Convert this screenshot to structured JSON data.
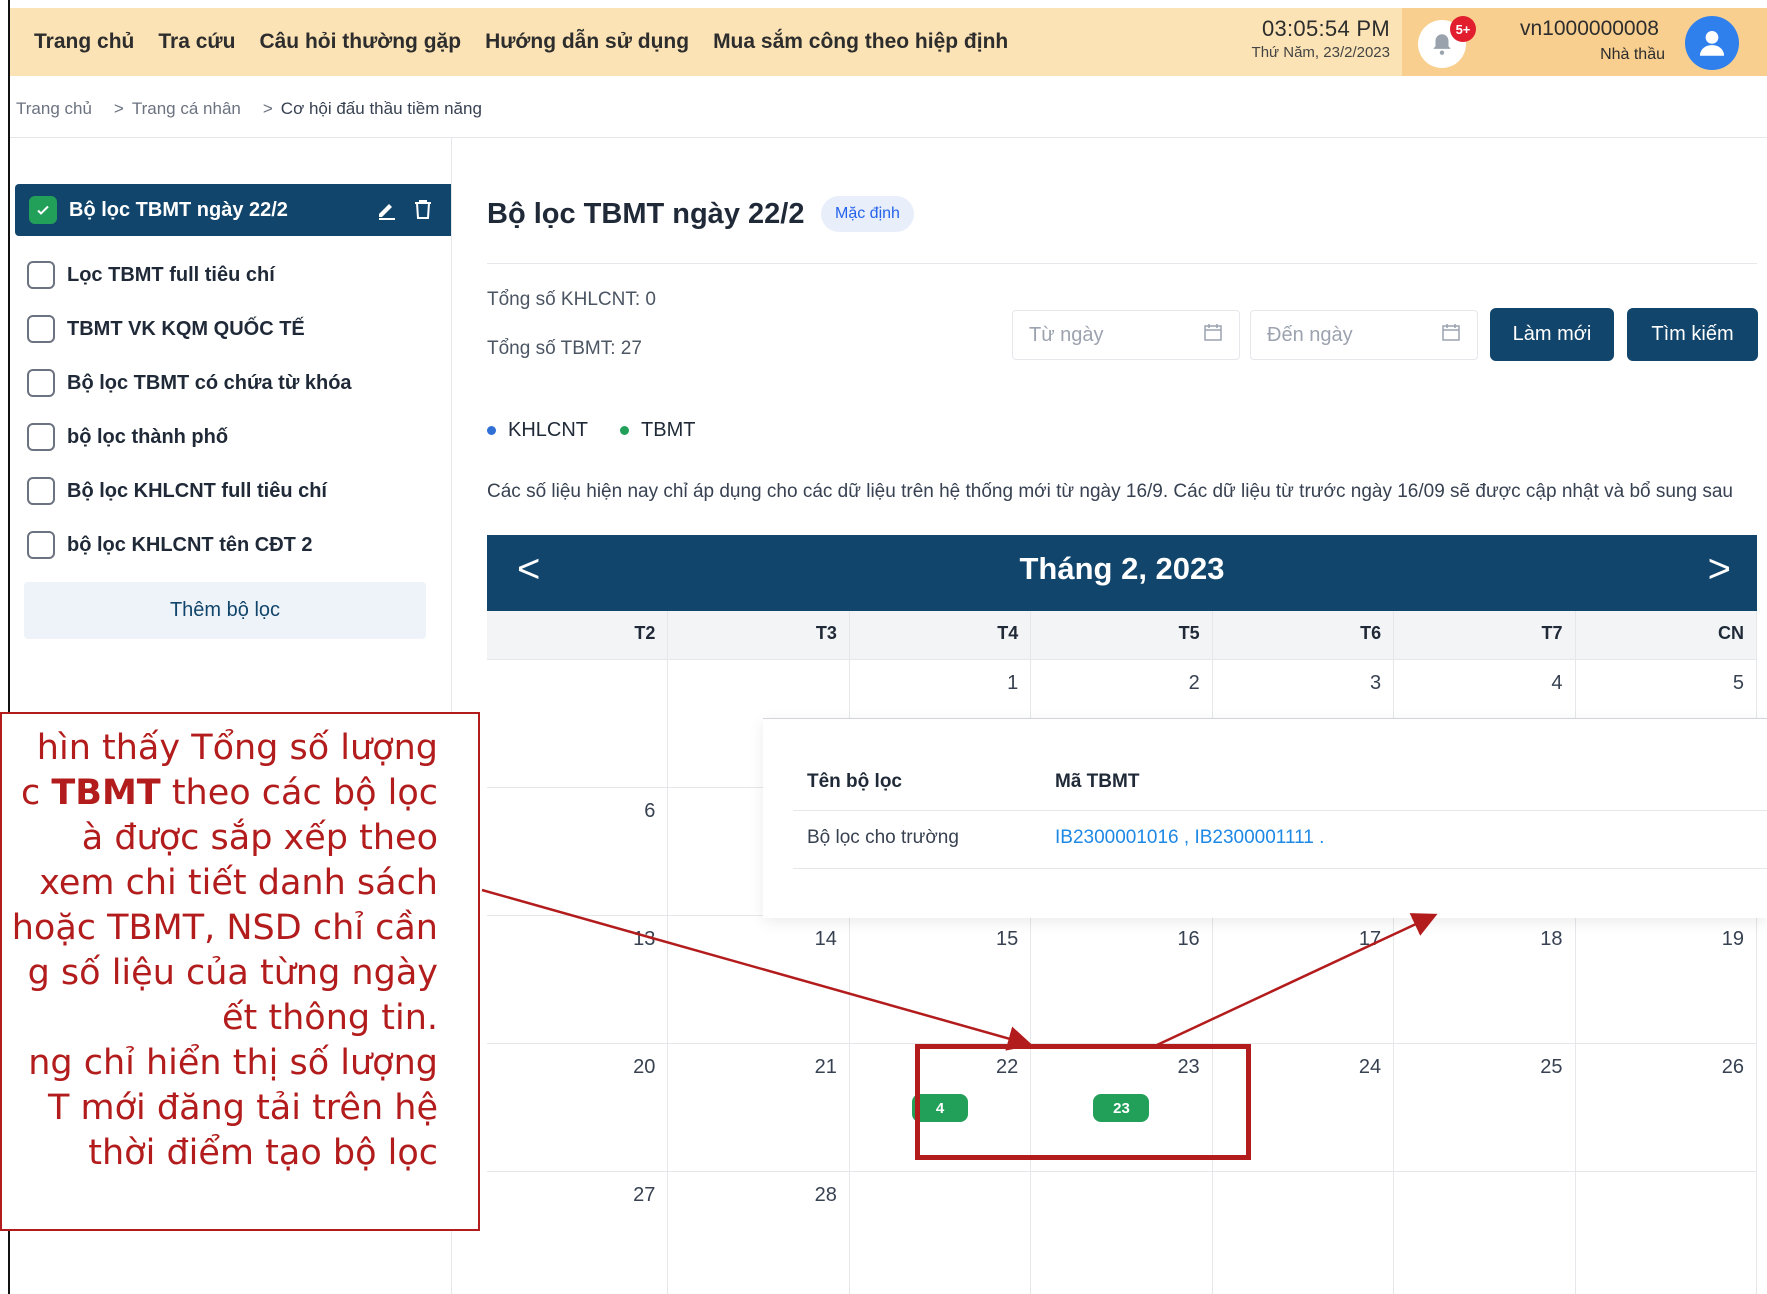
{
  "nav": {
    "items": [
      "Trang chủ",
      "Tra cứu",
      "Câu hỏi thường gặp",
      "Hướng dẫn sử dụng",
      "Mua sắm công theo hiệp định"
    ],
    "time": "03:05:54 PM",
    "date": "Thứ Năm, 23/2/2023",
    "notification_count": "5+",
    "username": "vn1000000008",
    "role": "Nhà thầu"
  },
  "breadcrumb": [
    "Trang chủ",
    "Trang cá nhân",
    "Cơ hội đấu thầu tiềm năng"
  ],
  "sidebar": {
    "active_filter": "Bộ lọc TBMT ngày 22/2",
    "filters": [
      "Lọc TBMT full tiêu chí",
      "TBMT VK KQM QUỐC TẾ",
      "Bộ lọc TBMT có chứa từ khóa",
      "bộ lọc thành phố",
      "Bộ lọc KHLCNT full tiêu chí",
      "bộ lọc KHLCNT tên CĐT 2"
    ],
    "add_filter_label": "Thêm bộ lọc"
  },
  "main": {
    "title": "Bộ lọc TBMT ngày 22/2",
    "default_badge": "Mặc định",
    "total_khlcnt": "Tổng số KHLCNT: 0",
    "total_tbmt": "Tổng số TBMT: 27",
    "from_date_placeholder": "Từ ngày",
    "to_date_placeholder": "Đến ngày",
    "refresh_label": "Làm mới",
    "search_label": "Tìm kiếm",
    "legend": {
      "khlcnt": "KHLCNT",
      "tbmt": "TBMT"
    },
    "note": "Các số liệu hiện nay chỉ áp dụng cho các dữ liệu trên hệ thống mới từ ngày 16/9. Các dữ liệu từ trước ngày 16/09 sẽ được cập nhật và bổ sung sau"
  },
  "calendar": {
    "title": "Tháng 2, 2023",
    "prev": "<",
    "next": ">",
    "weekdays": [
      "T2",
      "T3",
      "T4",
      "T5",
      "T6",
      "T7",
      "CN"
    ],
    "weeks": [
      [
        {
          "d": ""
        },
        {
          "d": ""
        },
        {
          "d": "1"
        },
        {
          "d": "2"
        },
        {
          "d": "3"
        },
        {
          "d": "4"
        },
        {
          "d": "5"
        }
      ],
      [
        {
          "d": "6"
        },
        {
          "d": ""
        },
        {
          "d": ""
        },
        {
          "d": ""
        },
        {
          "d": ""
        },
        {
          "d": ""
        },
        {
          "d": ""
        }
      ],
      [
        {
          "d": "13"
        },
        {
          "d": "14"
        },
        {
          "d": "15"
        },
        {
          "d": "16"
        },
        {
          "d": "17"
        },
        {
          "d": "18"
        },
        {
          "d": "19"
        }
      ],
      [
        {
          "d": "20"
        },
        {
          "d": "21"
        },
        {
          "d": "22",
          "count": "4"
        },
        {
          "d": "23",
          "count": "23"
        },
        {
          "d": "24"
        },
        {
          "d": "25"
        },
        {
          "d": "26"
        }
      ],
      [
        {
          "d": "27"
        },
        {
          "d": "28"
        },
        {
          "d": ""
        },
        {
          "d": ""
        },
        {
          "d": ""
        },
        {
          "d": ""
        },
        {
          "d": ""
        }
      ]
    ]
  },
  "popup": {
    "col_filter": "Tên bộ lọc",
    "col_code": "Mã TBMT",
    "row_filter": "Bộ lọc cho trường",
    "row_codes": "IB2300001016 , IB2300001111 ."
  },
  "callout": {
    "lines": [
      {
        "pre": "hìn thấy Tổng số lượng",
        "bold": "",
        "post": ""
      },
      {
        "pre": "c ",
        "bold": "TBMT",
        "post": " theo các bộ lọc"
      },
      {
        "pre": "à được sắp xếp theo",
        "bold": "",
        "post": ""
      },
      {
        "pre": " xem chi tiết danh sách",
        "bold": "",
        "post": ""
      },
      {
        "pre": "hoặc TBMT, NSD chỉ cần",
        "bold": "",
        "post": ""
      },
      {
        "pre": "g số liệu của từng ngày",
        "bold": "",
        "post": ""
      },
      {
        "pre": "ết thông tin.",
        "bold": "",
        "post": ""
      },
      {
        "pre": "ng chỉ hiển thị số lượng",
        "bold": "",
        "post": ""
      },
      {
        "pre": "T mới đăng tải trên hệ",
        "bold": "",
        "post": ""
      },
      {
        "pre": " thời điểm tạo bộ lọc",
        "bold": "",
        "post": ""
      }
    ]
  },
  "colors": {
    "nav_bg": "#fbe3b5",
    "user_bg": "#f9cf8f",
    "primary": "#12456b",
    "success": "#22a05a",
    "khlcnt_dot": "#2f6fd6",
    "tbmt_dot": "#22a05a",
    "annotation": "#b31c1c"
  }
}
